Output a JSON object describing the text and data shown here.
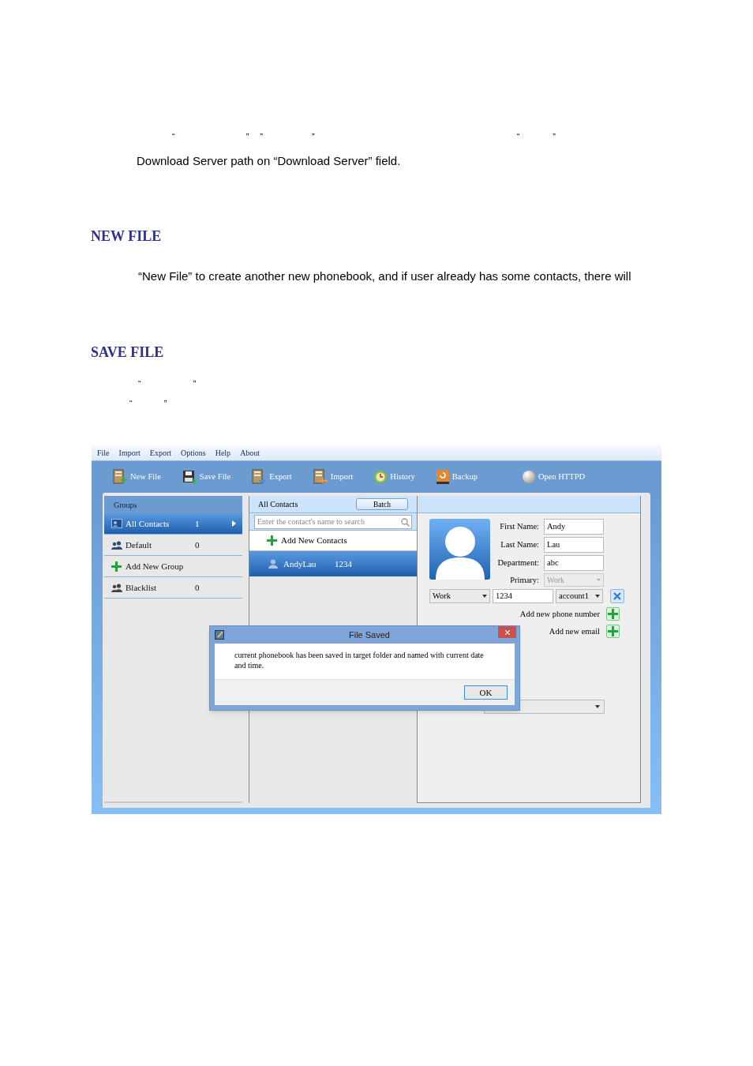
{
  "document": {
    "quote_marks_top": [
      "“",
      "”",
      "”",
      "”",
      "“",
      "”"
    ],
    "paragraph_1": "Download Server path on “Download Server” field.",
    "heading_1": "NEW FILE",
    "paragraph_2": "“New File” to create another new phonebook, and if user already has some contacts, there will",
    "heading_2": "SAVE FILE",
    "quote_marks_bottom_1": [
      "“",
      "”"
    ],
    "quote_marks_bottom_2": [
      "“",
      "”"
    ]
  },
  "app": {
    "menu": [
      "File",
      "Import",
      "Export",
      "Options",
      "Help",
      "About"
    ],
    "toolbar": [
      {
        "kind": "new-file",
        "label": "New File"
      },
      {
        "kind": "save-file",
        "label": "Save File"
      },
      {
        "kind": "export",
        "label": "Export"
      },
      {
        "kind": "import",
        "label": "Import"
      },
      {
        "kind": "history",
        "label": "History"
      },
      {
        "kind": "backup",
        "label": "Backup"
      },
      {
        "kind": "httpd",
        "label": "Open HTTPD"
      }
    ],
    "groups": {
      "title": "Groups",
      "items": [
        {
          "kind": "all",
          "label": "All Contacts",
          "count": "1",
          "selected": true
        },
        {
          "kind": "group",
          "label": "Default",
          "count": "0",
          "selected": false
        },
        {
          "kind": "add",
          "label": "Add New Group"
        },
        {
          "kind": "blacklist",
          "label": "Blacklist",
          "count": "0",
          "selected": false
        }
      ]
    },
    "contacts": {
      "title": "All Contacts",
      "batch_button": "Batch",
      "search_placeholder": "Enter the contact's name to search",
      "add_label": "Add New Contacts",
      "rows": [
        {
          "name": "AndyLau",
          "number": "1234",
          "selected": true
        }
      ]
    },
    "details": {
      "fields": [
        {
          "label": "First Name:",
          "value": "Andy"
        },
        {
          "label": "Last Name:",
          "value": "Lau"
        },
        {
          "label": "Department:",
          "value": "abc"
        }
      ],
      "primary": {
        "label": "Primary:",
        "value": "Work",
        "disabled": true
      },
      "phone": {
        "type": "Work",
        "number": "1234",
        "account": "account1"
      },
      "add_phone": "Add new phone number",
      "add_email": "Add new email"
    },
    "dialog": {
      "title": "File Saved",
      "message": "current phonebook has been saved in target folder and named with current date and time.",
      "ok": "OK"
    }
  }
}
